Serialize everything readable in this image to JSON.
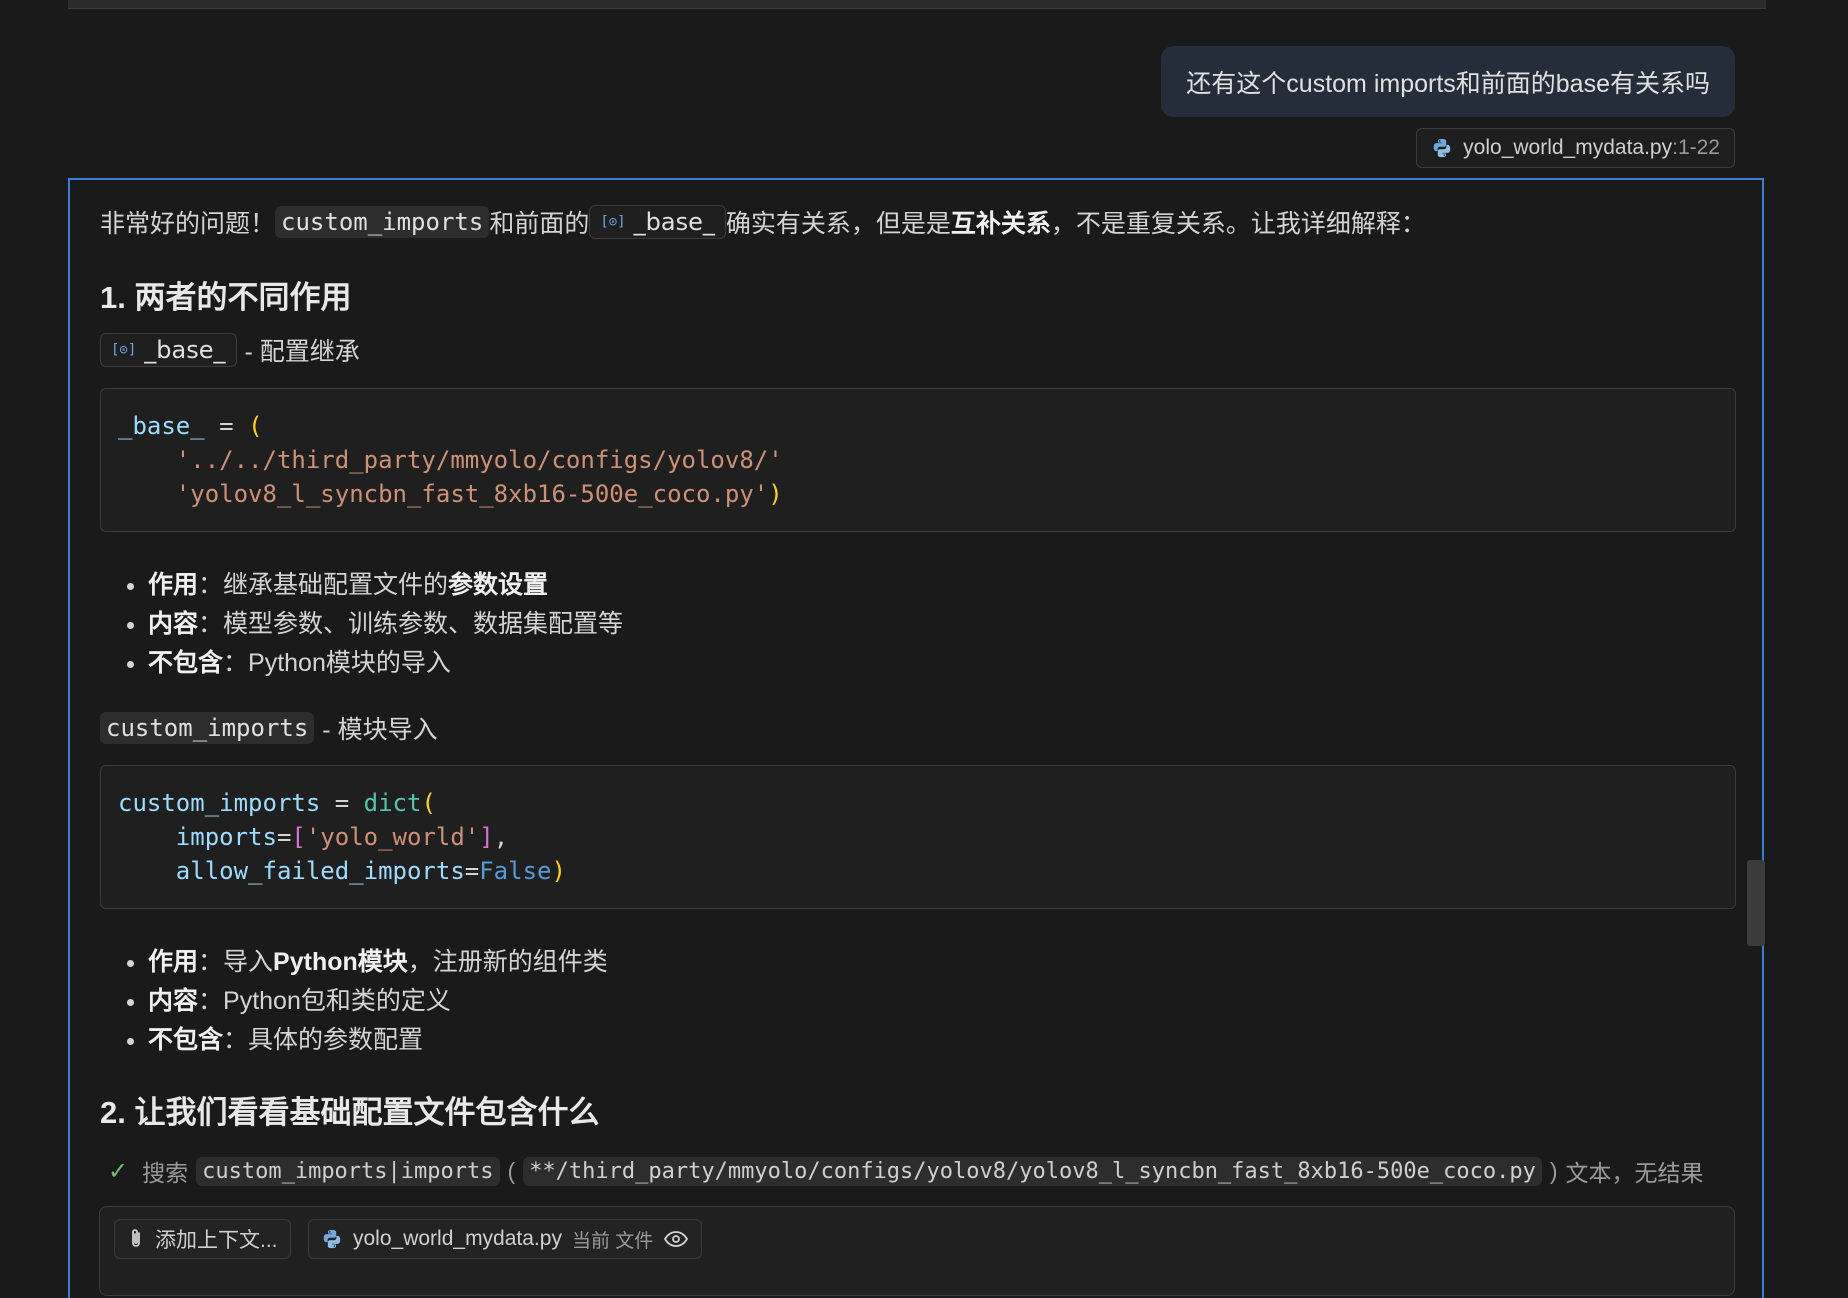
{
  "user_message": {
    "text": "还有这个custom imports和前面的base有关系吗",
    "ref_file": "yolo_world_mydata.py",
    "ref_range": ":1-22"
  },
  "response": {
    "intro": {
      "p1": "非常好的问题！",
      "code1": "custom_imports",
      "p2": "和前面的",
      "sym1": "_base_",
      "p3": "确实有关系，但是是",
      "bold1": "互补关系",
      "p4": "，不是重复关系。让我详细解释："
    },
    "heading1": "1. 两者的不同作用",
    "base_section": {
      "sym": "_base_",
      "label": "- 配置继承",
      "code": {
        "line1_var": "_base_",
        "line1_op": " = ",
        "line1_par": "(",
        "line2": "'../../third_party/mmyolo/configs/yolov8/'",
        "line3": "'yolov8_l_syncbn_fast_8xb16-500e_coco.py'",
        "line3_close": ")"
      },
      "bullets": [
        {
          "label": "作用",
          "sep": "：",
          "text": "继承基础配置文件的",
          "bold": "参数设置"
        },
        {
          "label": "内容",
          "sep": "：",
          "text": "模型参数、训练参数、数据集配置等",
          "bold": ""
        },
        {
          "label": "不包含",
          "sep": "：",
          "text": "Python模块的导入",
          "bold": ""
        }
      ]
    },
    "imports_section": {
      "code_label": "custom_imports",
      "label": "- 模块导入",
      "code": {
        "line1_var": "custom_imports",
        "line1_op": " = ",
        "line1_fn": "dict",
        "line1_par": "(",
        "line2_var": "imports",
        "line2_op": "=",
        "line2_brk_open": "[",
        "line2_str": "'yolo_world'",
        "line2_brk_close": "]",
        "line2_comma": ",",
        "line3_var": "allow_failed_imports",
        "line3_op": "=",
        "line3_bool": "False",
        "line3_close": ")"
      },
      "bullets": [
        {
          "label": "作用",
          "sep": "：",
          "text": "导入",
          "bold": "Python模块",
          "tail": "，注册新的组件类"
        },
        {
          "label": "内容",
          "sep": "：",
          "text": "Python包和类的定义",
          "bold": "",
          "tail": ""
        },
        {
          "label": "不包含",
          "sep": "：",
          "text": "具体的参数配置",
          "bold": "",
          "tail": ""
        }
      ]
    },
    "heading2": "2. 让我们看看基础配置文件包含什么",
    "tool_call": {
      "action": "搜索",
      "query": "custom_imports|imports",
      "open_paren": "(",
      "path": "**/third_party/mmyolo/configs/yolov8/yolov8_l_syncbn_fast_8xb16-500e_coco.py",
      "close_paren": ")",
      "result": "文本，无结果"
    }
  },
  "composer": {
    "add_context": "添加上下文...",
    "file_name": "yolo_world_mydata.py",
    "file_tag": "当前 文件"
  },
  "colors": {
    "accent_border": "#3a7fd5",
    "background": "#1a1a1a",
    "user_bubble": "#252c3a"
  }
}
